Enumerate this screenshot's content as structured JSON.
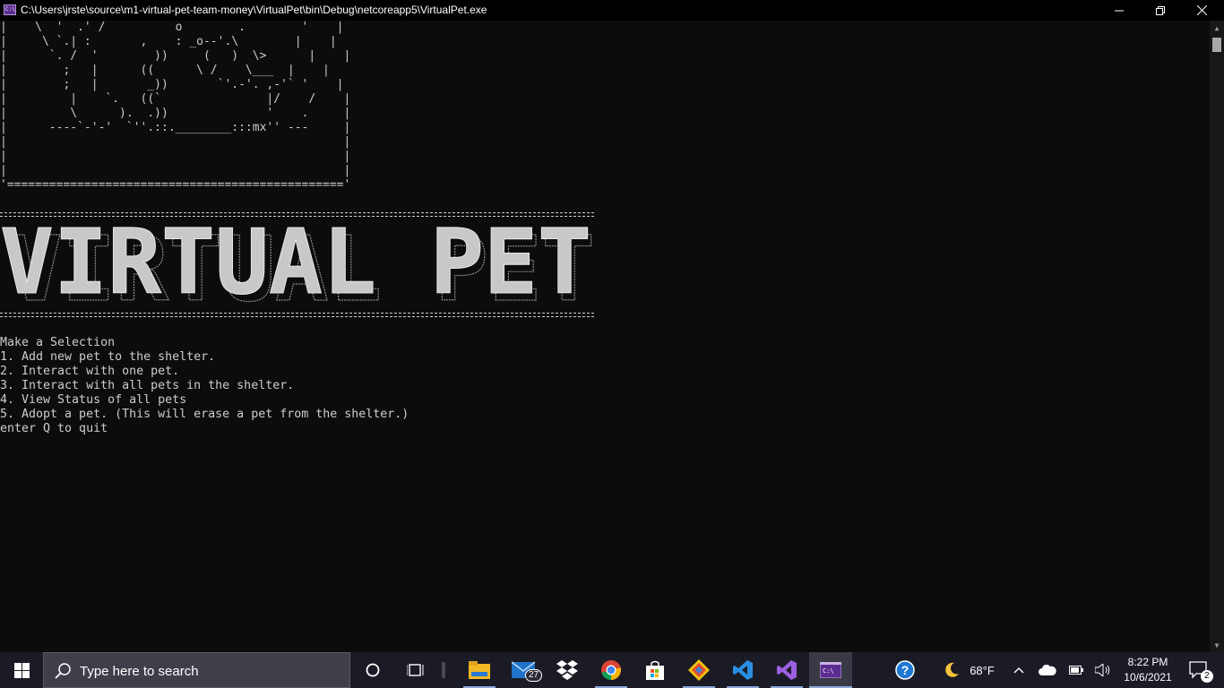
{
  "window": {
    "title": "C:\\Users\\jrste\\source\\m1-virtual-pet-team-money\\VirtualPet\\bin\\Debug\\netcoreapp5\\VirtualPet.exe",
    "icon": "console-app-icon",
    "minimize_label": "—",
    "restore_label": "❐",
    "close_label": "✕"
  },
  "console": {
    "ascii_art": "|    \\  '  .' /          o        .        '    |\n|     \\ `.| :       ,    : _o--'.\\        |    |\n|      `. /  '        ))     (   )  \\>      |    |\n|        ;   |      ((      \\ /    \\___  |    |\n|        ;   |       _))       `'.-'. ,-'` '    |\n|         |    `.   ((`               |/    /    |\n|         \\      ).  .))              '    .     |\n|      ----`-'-'  `''.::.________:::mx'' ---     |\n|                                                |\n|                                                |\n|                                                |\n'================================================'",
    "banner_text": "VIRTUAL PET",
    "menu": [
      "Make a Selection",
      "1. Add new pet to the shelter.",
      "2. Interact with one pet.",
      "3. Interact with all pets in the shelter.",
      "4. View Status of all pets",
      "5. Adopt a pet. (This will erase a pet from the shelter.)",
      "enter Q to quit"
    ],
    "text_color": "#cccccc",
    "background_color": "#0c0c0c"
  },
  "taskbar": {
    "search_placeholder": "Type here to search",
    "mail_badge": "27",
    "weather_temp": "68°F",
    "time": "8:22 PM",
    "date": "10/6/2021",
    "notification_count": "2",
    "apps": [
      "file-explorer-icon",
      "mail-icon",
      "dropbox-icon",
      "chrome-icon",
      "store-icon",
      "git-icon",
      "vscode-icon",
      "visual-studio-icon",
      "terminal-icon"
    ]
  }
}
